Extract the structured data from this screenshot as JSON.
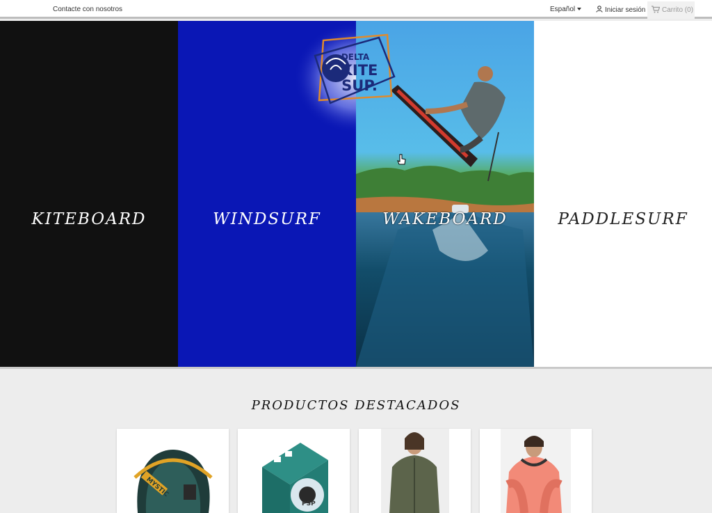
{
  "header": {
    "contact_label": "Contacte con nosotros",
    "language_label": "Español",
    "login_label": "Iniciar sesión",
    "cart_label": "Carrito",
    "cart_count": "(0)"
  },
  "logo": {
    "line1": "DELTA",
    "line2": "KITE",
    "line3": "SUP."
  },
  "hero": {
    "panels": [
      {
        "label": "KITEBOARD",
        "color": "#111111"
      },
      {
        "label": "WINDSURF",
        "color": "#0a17b5"
      },
      {
        "label": "WAKEBOARD",
        "color": "#3f9fd6"
      },
      {
        "label": "PADDLESURF",
        "color": "#ffffff"
      }
    ]
  },
  "featured": {
    "title": "PRODUCTOS DESTACADOS",
    "products": [
      {
        "image": "kite-harness",
        "brand_text": "MYSTIC"
      },
      {
        "image": "repair-tape",
        "brand_text": "PSP"
      },
      {
        "image": "olive-parka"
      },
      {
        "image": "coral-hoodie"
      }
    ]
  },
  "icons": {
    "user": "user-icon",
    "cart": "cart-icon",
    "cursor": "hand-cursor-icon"
  }
}
